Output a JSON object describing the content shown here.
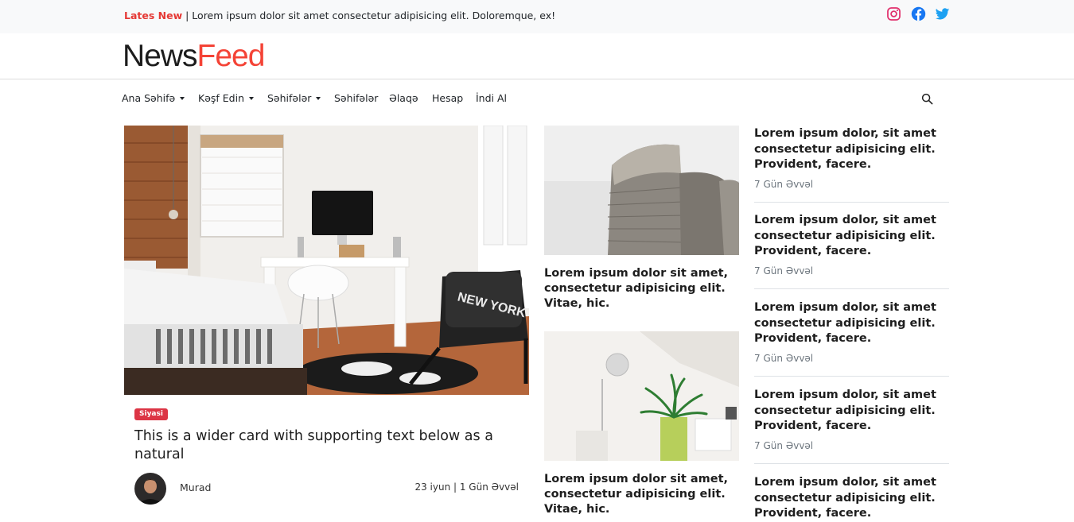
{
  "topbar": {
    "latest_label": "Lates New",
    "latest_text": " | Lorem ipsum dolor sit amet consectetur adipisicing elit. Doloremque, ex!",
    "social": [
      "instagram-icon",
      "facebook-icon",
      "twitter-icon"
    ]
  },
  "brand": {
    "part1": "News",
    "part2": "Feed",
    "accent_color": "#f44336"
  },
  "nav": {
    "items": [
      {
        "label": "Ana Səhifə",
        "dropdown": true
      },
      {
        "label": "Kəşf Edin",
        "dropdown": true
      },
      {
        "label": "Səhifələr",
        "dropdown": true
      },
      {
        "label": "Səhifələr",
        "dropdown": false
      },
      {
        "label": "Əlaqə",
        "dropdown": false
      },
      {
        "label": "Hesap",
        "dropdown": false
      },
      {
        "label": "İndi Al",
        "dropdown": false
      }
    ],
    "search_icon": "search-icon"
  },
  "hero": {
    "badge": "Siyasi",
    "badge_color": "#dc3545",
    "title": "This is a wider card with supporting text below as a natural",
    "author": "Murad",
    "meta": "23 iyun | 1 Gün Əvvəl"
  },
  "middle": [
    {
      "title": "Lorem ipsum dolor sit amet, consectetur adipisicing elit. Vitae, hic."
    },
    {
      "title": "Lorem ipsum dolor sit amet, consectetur adipisicing elit. Vitae, hic."
    }
  ],
  "list": [
    {
      "title": "Lorem ipsum dolor, sit amet consectetur adipisicing elit. Provident, facere.",
      "time": "7 Gün Əvvəl"
    },
    {
      "title": "Lorem ipsum dolor, sit amet consectetur adipisicing elit. Provident, facere.",
      "time": "7 Gün Əvvəl"
    },
    {
      "title": "Lorem ipsum dolor, sit amet consectetur adipisicing elit. Provident, facere.",
      "time": "7 Gün Əvvəl"
    },
    {
      "title": "Lorem ipsum dolor, sit amet consectetur adipisicing elit. Provident, facere.",
      "time": "7 Gün Əvvəl"
    },
    {
      "title": "Lorem ipsum dolor, sit amet consectetur adipisicing elit. Provident, facere.",
      "time": ""
    }
  ]
}
